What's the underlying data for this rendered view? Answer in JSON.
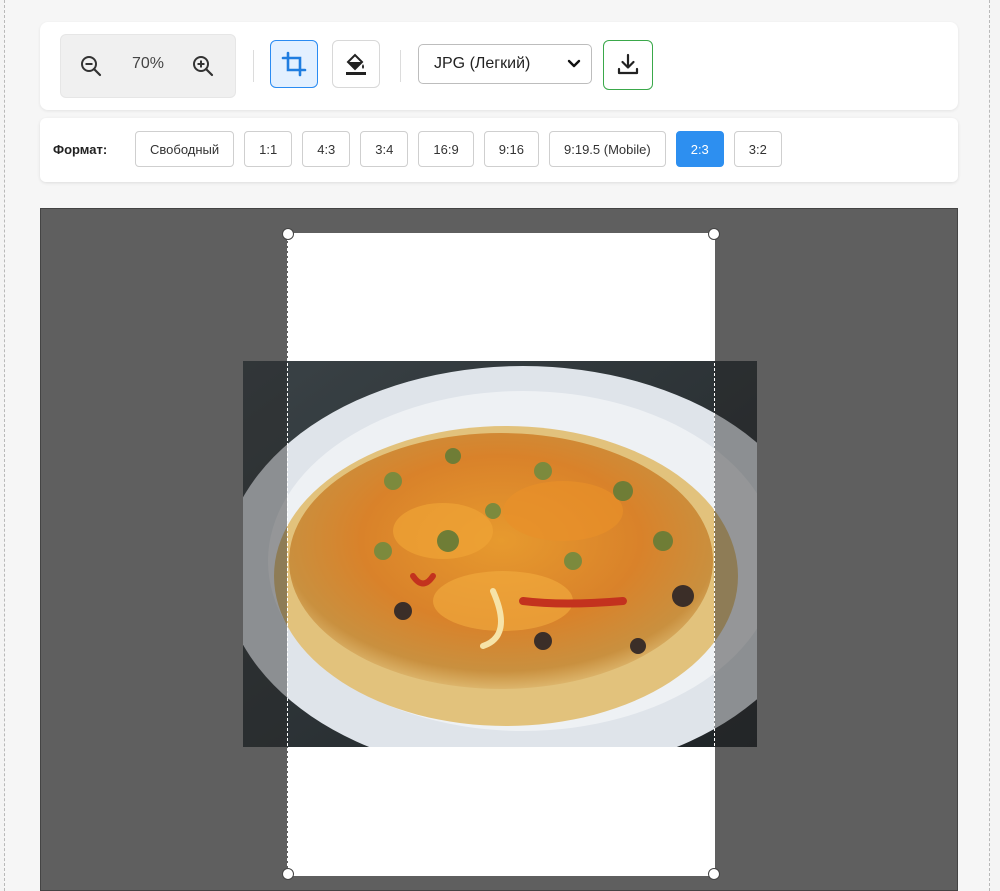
{
  "toolbar": {
    "zoom_value": "70%",
    "format_select": {
      "selected": "JPG (Легкий)"
    },
    "icons": {
      "zoom_out": "zoom-out-icon",
      "zoom_in": "zoom-in-icon",
      "crop": "crop-icon",
      "fill": "paint-bucket-icon",
      "download": "download-icon",
      "chevron": "chevron-down-icon"
    },
    "colors": {
      "crop_active_border": "#2a8bf2",
      "crop_active_bg": "#e3f0ff",
      "download_border": "#3aa84a"
    }
  },
  "ratio_bar": {
    "label": "Формат:",
    "options": [
      "Свободный",
      "1:1",
      "4:3",
      "3:4",
      "16:9",
      "9:16",
      "9:19.5 (Mobile)",
      "2:3",
      "3:2"
    ],
    "active": "2:3",
    "active_color": "#2d8ff0"
  },
  "canvas": {
    "background": "#5f5f5f",
    "image_subject": "pizza-photo"
  }
}
